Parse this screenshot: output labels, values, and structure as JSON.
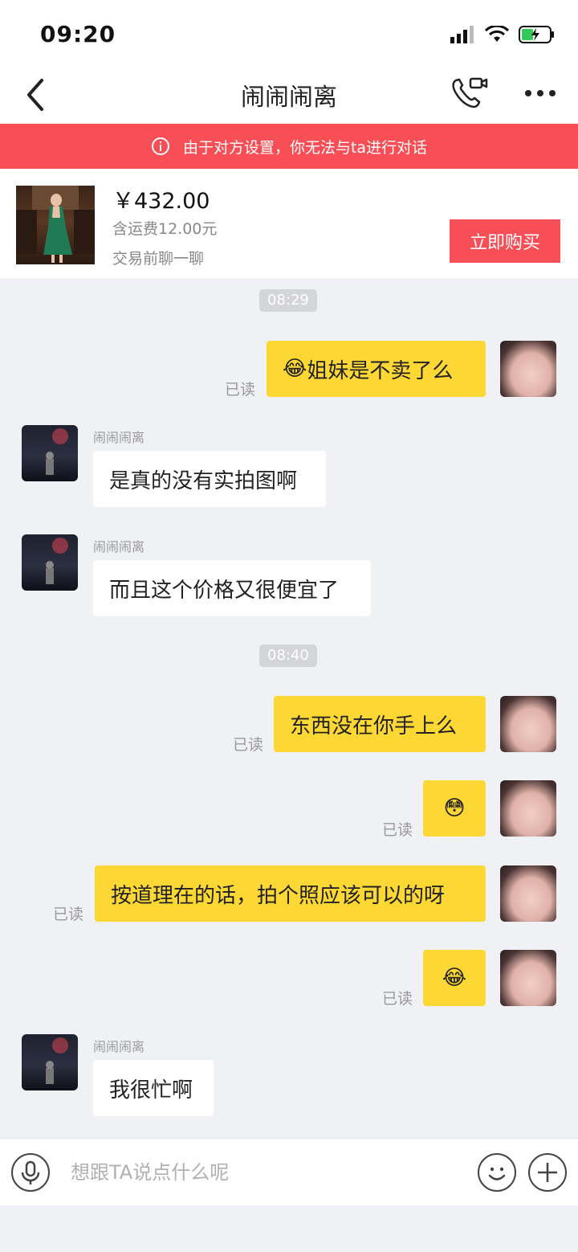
{
  "status_bar": {
    "time": "09:20"
  },
  "nav": {
    "title": "闹闹闹离"
  },
  "notice": {
    "text": "由于对方设置，你无法与ta进行对话"
  },
  "product": {
    "price": "￥432.00",
    "shipping": "含运费12.00元",
    "chat_before": "交易前聊一聊",
    "buy_label": "立即购买"
  },
  "timestamps": [
    "08:29",
    "08:40"
  ],
  "messages": [
    {
      "from": "me",
      "text": "姐妹是不卖了么",
      "emoji_prefix": "😂",
      "read": "已读"
    },
    {
      "from": "other",
      "sender": "闹闹闹离",
      "text": "是真的没有实拍图啊"
    },
    {
      "from": "other",
      "sender": "闹闹闹离",
      "text": "而且这个价格又很便宜了"
    },
    {
      "from": "me",
      "text": "东西没在你手上么",
      "read": "已读"
    },
    {
      "from": "me",
      "text": "😳",
      "read": "已读"
    },
    {
      "from": "me",
      "text": "按道理在的话，拍个照应该可以的呀",
      "read": "已读"
    },
    {
      "from": "me",
      "text": "😂",
      "read": "已读"
    },
    {
      "from": "other",
      "sender": "闹闹闹离",
      "text": "我很忙啊"
    }
  ],
  "input": {
    "placeholder": "想跟TA说点什么呢"
  },
  "icons": {
    "back": "chevron-left-icon",
    "call": "video-call-icon",
    "more": "more-dots-icon",
    "info": "info-icon",
    "mic": "microphone-icon",
    "emoji": "smiley-icon",
    "plus": "plus-icon"
  },
  "colors": {
    "accent_red": "#f84f57",
    "bubble_me": "#fdd835",
    "background": "#f0f1f5"
  }
}
